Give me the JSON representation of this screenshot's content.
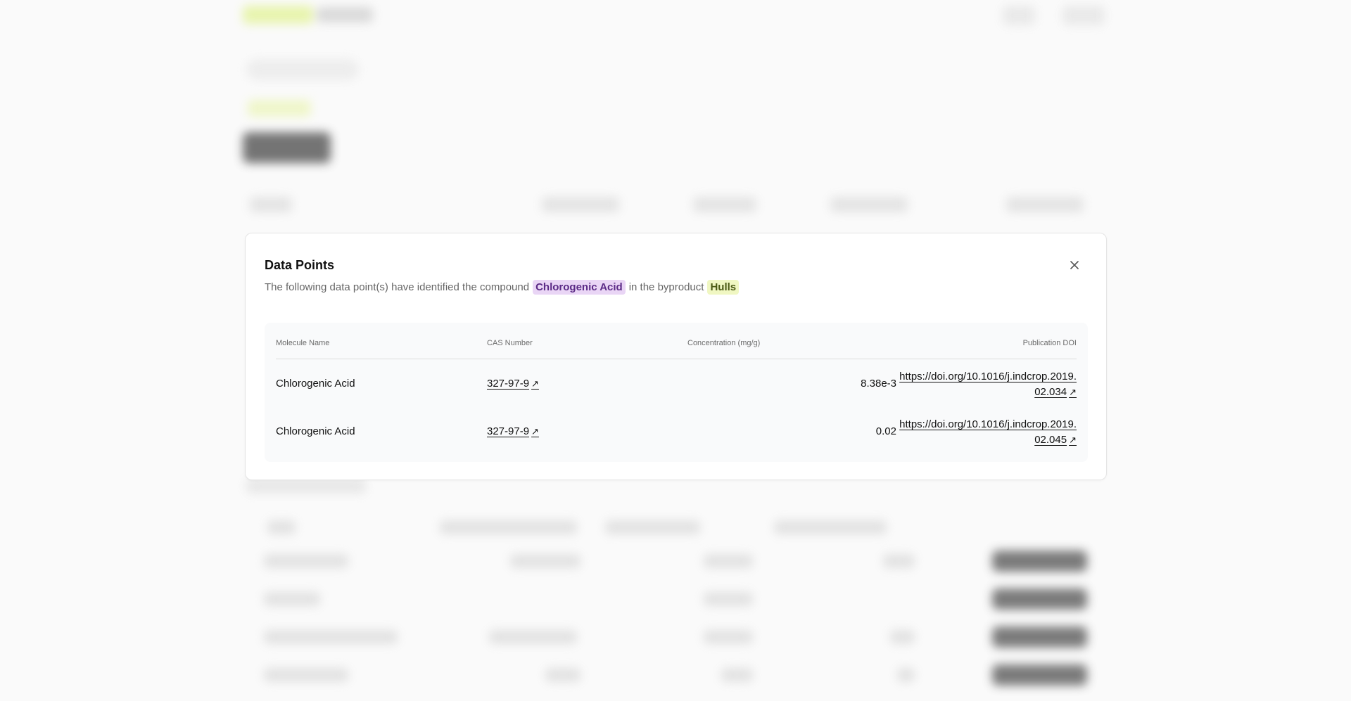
{
  "modal": {
    "title": "Data Points",
    "description_prefix": "The following data point(s) have identified the compound",
    "compound": "Chlorogenic Acid",
    "description_middle": "in the byproduct",
    "byproduct": "Hulls",
    "close_icon": "close-icon"
  },
  "table": {
    "headers": {
      "molecule_name": "Molecule Name",
      "cas_number": "CAS Number",
      "concentration": "Concentration (mg/g)",
      "publication_doi": "Publication DOI"
    },
    "rows": [
      {
        "molecule_name": "Chlorogenic Acid",
        "cas_number": "327-97-9",
        "concentration": "8.38e-3",
        "doi_line1": "https://doi.org/10.1016/j.indcrop.2019.",
        "doi_line2": "02.034"
      },
      {
        "molecule_name": "Chlorogenic Acid",
        "cas_number": "327-97-9",
        "concentration": "0.02",
        "doi_line1": "https://doi.org/10.1016/j.indcrop.2019.",
        "doi_line2": "02.045"
      }
    ],
    "external_link_icon": "external-link-icon"
  },
  "colors": {
    "compound_chip_bg": "#e9d5f5",
    "compound_chip_text": "#5b2a86",
    "byproduct_chip_bg": "#f0f7c2",
    "byproduct_chip_text": "#4b5a14",
    "modal_bg": "#ffffff",
    "table_bg": "#f9fafb"
  }
}
